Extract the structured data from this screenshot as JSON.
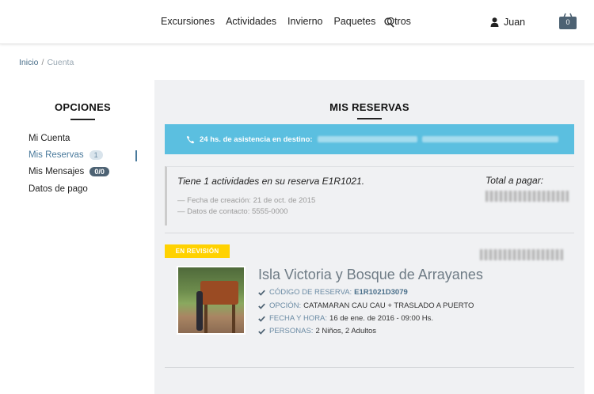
{
  "header": {
    "nav": [
      "Excursiones",
      "Actividades",
      "Invierno",
      "Paquetes",
      "Otros"
    ],
    "user_name": "Juan",
    "cart_count": "0"
  },
  "breadcrumb": {
    "home": "Inicio",
    "separator": "/",
    "current": "Cuenta"
  },
  "sidebar": {
    "title": "OPCIONES",
    "items": [
      {
        "label": "Mi Cuenta"
      },
      {
        "label": "Mis Reservas",
        "badge": "1"
      },
      {
        "label": "Mis Mensajes",
        "badge": "0/0"
      },
      {
        "label": "Datos de pago"
      }
    ]
  },
  "main": {
    "title": "MIS RESERVAS",
    "assistance": "24 hs. de asistencia en destino:",
    "summary": {
      "text": "Tiene 1 actividades en su reserva E1R1021.",
      "created": "— Fecha de creación: 21 de oct. de 2015",
      "contact": "— Datos de contacto: 5555-0000",
      "total_label": "Total a pagar:"
    },
    "booking": {
      "status": "EN REVISIÓN",
      "title": "Isla Victoria y Bosque de Arrayanes",
      "details": [
        {
          "label": "CÓDIGO DE RESERVA:",
          "value": "E1R1021D3079"
        },
        {
          "label": "OPCIÓN:",
          "value": "CATAMARAN CAU CAU + TRASLADO A PUERTO"
        },
        {
          "label": "FECHA Y HORA:",
          "value": "16 de ene. de 2016 - 09:00 Hs."
        },
        {
          "label": "PERSONAS:",
          "value": "2 Niños, 2 Adultos"
        }
      ]
    }
  },
  "colors": {
    "accent": "#5bbfe0",
    "status": "#ffd200",
    "link": "#4a7a9c"
  }
}
